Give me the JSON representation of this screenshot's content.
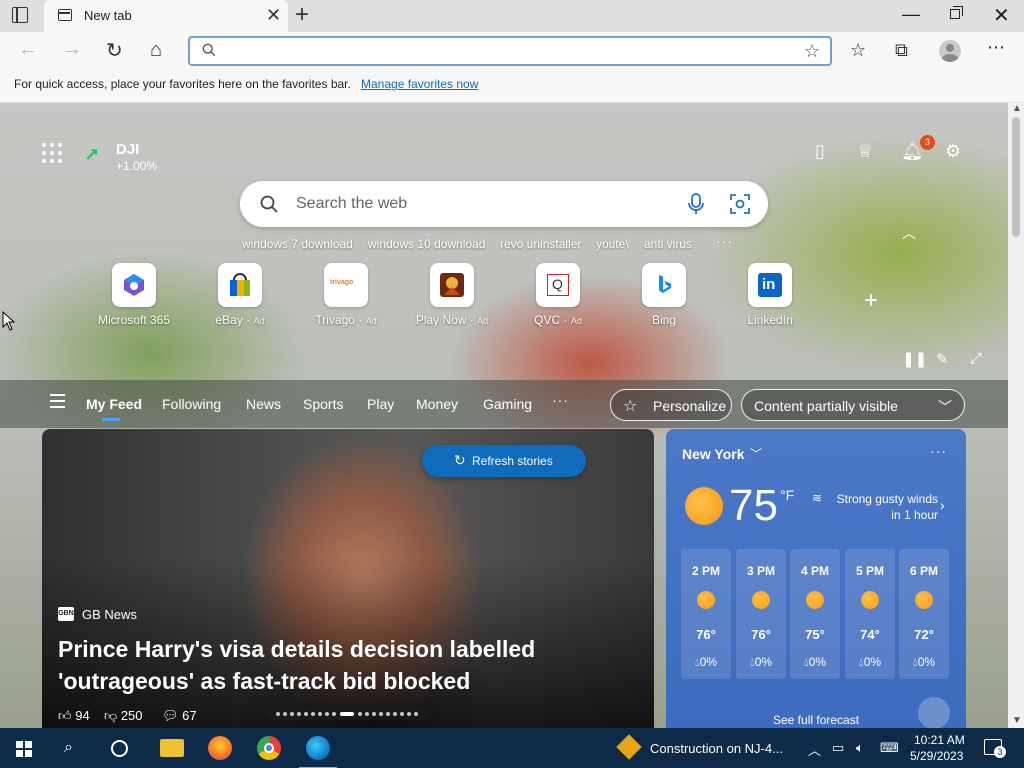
{
  "browser": {
    "tab_title": "New tab",
    "address_value": "",
    "favorites_bar": {
      "prompt": "For quick access, place your favorites here on the favorites bar.",
      "link": "Manage favorites now"
    }
  },
  "newtab": {
    "stock": {
      "symbol": "DJI",
      "change": "+1.00%",
      "trend": "up"
    },
    "notifications_count": "3",
    "search_placeholder": "Search the web",
    "trending": [
      "windows 7 download",
      "windows 10 download",
      "revo uninstaller",
      "youte\\",
      "anti virus"
    ],
    "quick_links": [
      {
        "label": "Microsoft 365",
        "ad": "",
        "icon": "microsoft-365-icon"
      },
      {
        "label": "eBay",
        "ad": "Ad",
        "icon": "ebay-icon"
      },
      {
        "label": "Trivago",
        "ad": "Ad",
        "icon": "trivago-icon"
      },
      {
        "label": "Play Now",
        "ad": "Ad",
        "icon": "play-now-icon"
      },
      {
        "label": "QVC",
        "ad": "Ad",
        "icon": "qvc-icon"
      },
      {
        "label": "Bing",
        "ad": "",
        "icon": "bing-icon"
      },
      {
        "label": "LinkedIn",
        "ad": "",
        "icon": "linkedin-icon"
      }
    ],
    "trivago_icon_text": "trivago",
    "qvc_icon_text": "Q",
    "linkedin_icon_text": "in"
  },
  "feed": {
    "tabs": [
      "My Feed",
      "Following",
      "News",
      "Sports",
      "Play",
      "Money",
      "Gaming"
    ],
    "active_tab": "My Feed",
    "personalize_label": "Personalize",
    "content_visibility": "Content partially visible",
    "refresh_label": "Refresh stories",
    "hero": {
      "source_logo": "GBN",
      "source": "GB News",
      "headline": "Prince Harry's visa details decision labelled 'outrageous' as fast-track bid blocked",
      "likes": "94",
      "dislikes": "250",
      "comments": "67"
    }
  },
  "weather": {
    "city": "New York",
    "temp": "75",
    "unit": "°F",
    "alert": "Strong gusty winds in 1 hour",
    "hourly": [
      {
        "time": "2 PM",
        "temp": "76°",
        "precip": "0%"
      },
      {
        "time": "3 PM",
        "temp": "76°",
        "precip": "0%"
      },
      {
        "time": "4 PM",
        "temp": "75°",
        "precip": "0%"
      },
      {
        "time": "5 PM",
        "temp": "74°",
        "precip": "0%"
      },
      {
        "time": "6 PM",
        "temp": "72°",
        "precip": "0%"
      }
    ],
    "forecast_link": "See full forecast"
  },
  "taskbar": {
    "news_ticker": "Construction on NJ-4...",
    "time": "10:21 AM",
    "date": "5/29/2023",
    "notification_count": "3"
  },
  "colors": {
    "accent": "#0f6cbd",
    "weather_card": "#4274c4",
    "taskbar": "#0d2b48",
    "stock_up": "#22c55e"
  }
}
